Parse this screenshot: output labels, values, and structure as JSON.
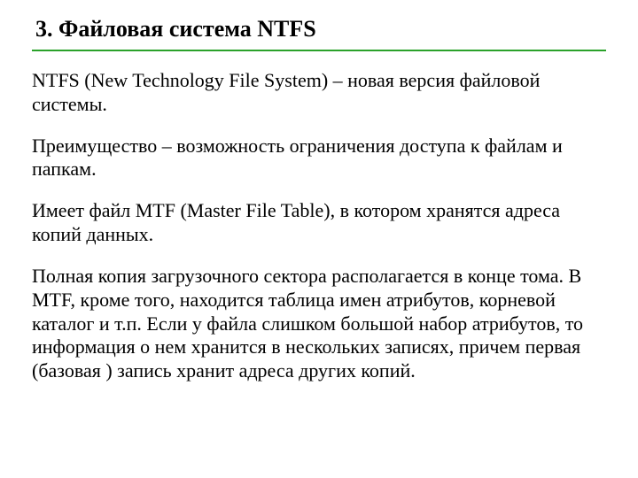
{
  "slide": {
    "title": "3. Файловая система NTFS",
    "paragraphs": [
      "NTFS (New Technology File System) – новая версия файловой системы.",
      "Преимущество – возможность ограничения доступа к файлам и папкам.",
      "Имеет файл MTF (Master File Table), в котором хранятся адреса копий данных.",
      "Полная копия загрузочного сектора располагается в конце тома. В MTF, кроме того, находится таблица имен атрибутов, корневой каталог и т.п. Если у файла слишком большой набор атрибутов, то информация о нем хранится в нескольких записях, причем первая (базовая ) запись хранит адреса других копий."
    ]
  }
}
